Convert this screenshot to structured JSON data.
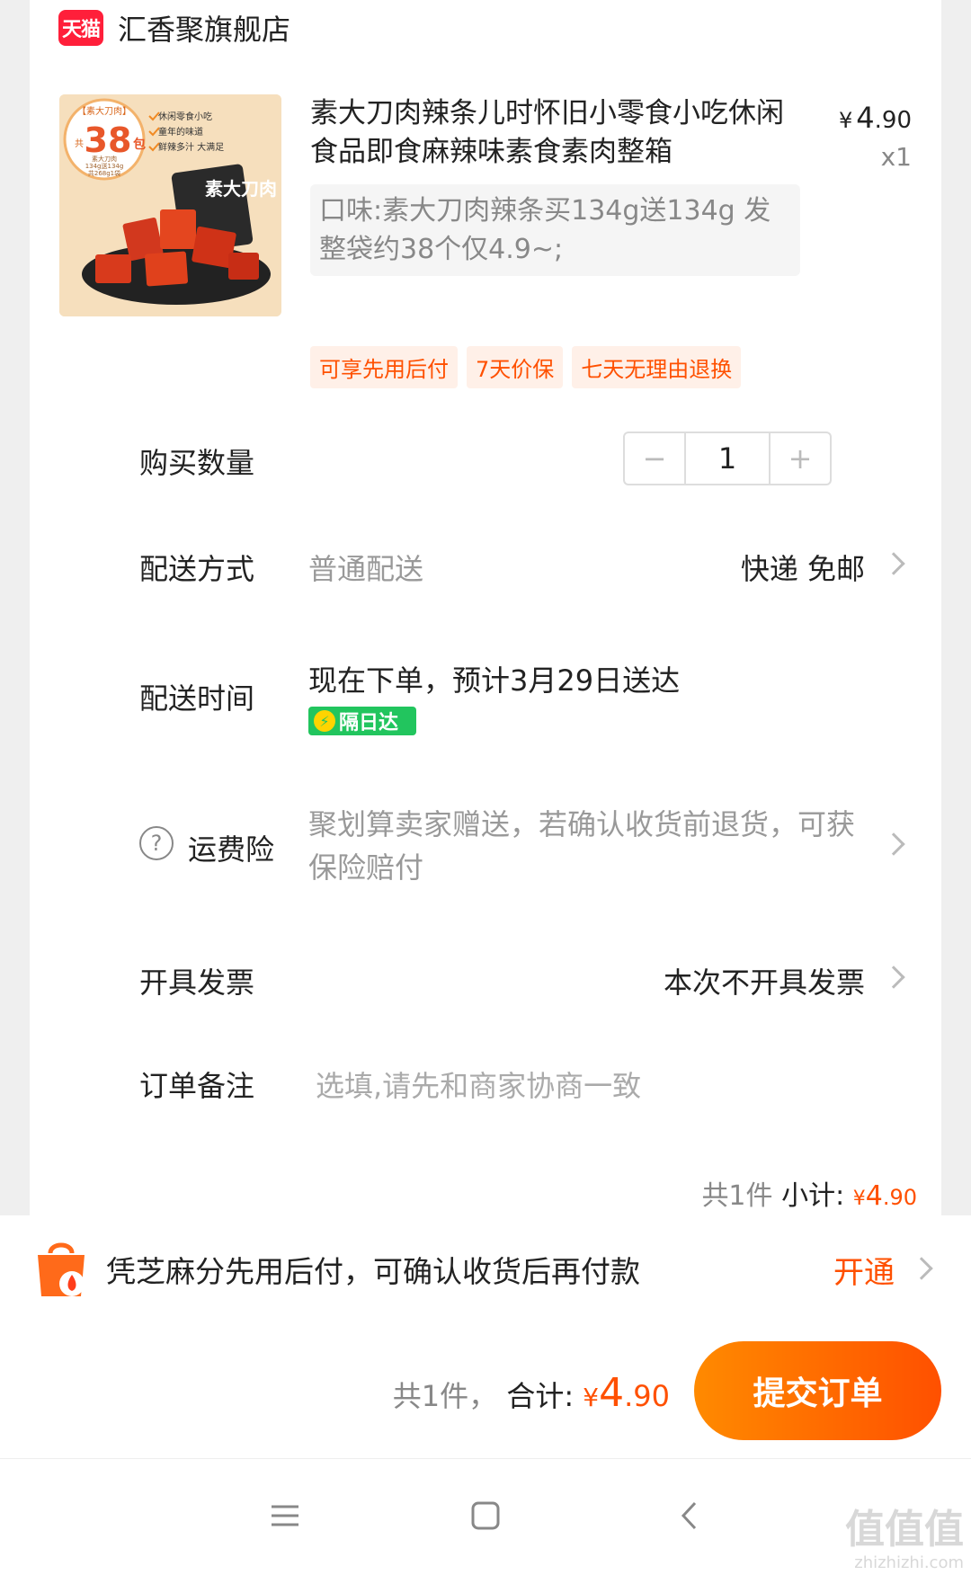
{
  "store": {
    "badge": "天猫",
    "name": "汇香聚旗舰店"
  },
  "product": {
    "title": "素大刀肉辣条儿时怀旧小零食小吃休闲食品即食麻辣味素食素肉整箱",
    "price_symbol": "¥",
    "price_int": "4",
    "price_dec": ".90",
    "quantity_label": "x1",
    "sku": "口味:素大刀肉辣条买134g送134g 发整袋约38个仅4.9~;",
    "image_text": {
      "brand": "【素大刀肉】",
      "count_prefix": "共",
      "count": "38",
      "count_suffix": "包",
      "bullets": [
        "休闲零食小吃",
        "童年的味道",
        "鲜辣多汁 大满足"
      ],
      "spec_lines": [
        "素大刀肉",
        "134g送134g",
        "共268g1袋"
      ],
      "pack_text": "素大刀肉"
    },
    "tags": [
      "可享先用后付",
      "7天价保",
      "七天无理由退换"
    ]
  },
  "quantity": {
    "label": "购买数量",
    "minus": "−",
    "value": "1",
    "plus": "+"
  },
  "delivery": {
    "label": "配送方式",
    "method": "普通配送",
    "value": "快递 免邮"
  },
  "delivery_time": {
    "label": "配送时间",
    "value": "现在下单，预计3月29日送达",
    "badge": "隔日达"
  },
  "insurance": {
    "label": "运费险",
    "value": "聚划算卖家赠送，若确认收货前退货，可获保险赔付"
  },
  "invoice": {
    "label": "开具发票",
    "value": "本次不开具发票"
  },
  "remark": {
    "label": "订单备注",
    "placeholder": "选填,请先和商家协商一致"
  },
  "subtotal": {
    "count": "共1件",
    "label": "小计:",
    "symbol": "¥",
    "int": "4",
    "dec": ".90"
  },
  "promo": {
    "text": "凭芝麻分先用后付，可确认收货后再付款",
    "action": "开通"
  },
  "footer": {
    "count": "共1件，",
    "label": "合计:",
    "symbol": "¥",
    "int": "4",
    "dec": ".90",
    "submit": "提交订单"
  },
  "watermark": {
    "main": "值值值",
    "url": "zhizhizhi.com"
  },
  "colors": {
    "accent": "#ff5000",
    "tmall": "#ff1f3a",
    "nextday": "#22c55e"
  }
}
